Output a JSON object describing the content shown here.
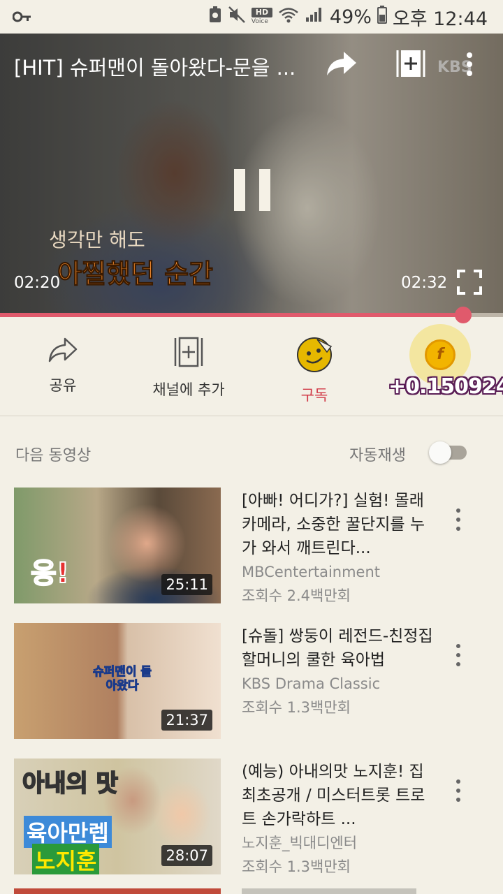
{
  "status_bar": {
    "hd_label": "HD",
    "voice_label": "Voice",
    "battery": "49%",
    "time": "오후 12:44"
  },
  "player": {
    "title": "[HIT] 슈퍼맨이 돌아왔다-문을 ...",
    "current_time": "02:20",
    "duration": "02:32",
    "progress": 0.921,
    "watermark": "KBS",
    "subtitle_line1": "생각만 해도",
    "subtitle_line2": "아찔했던 순간",
    "accent_color": "#e05a6c"
  },
  "actions": {
    "share": "공유",
    "add_to_channel": "채널에 추가",
    "subscribe": "구독",
    "coin_symbol": "f",
    "coin_value": "+0.150924"
  },
  "up_next": {
    "label": "다음 동영상",
    "autoplay_label": "자동재생",
    "autoplay_on": false
  },
  "videos": [
    {
      "title": "[아빠! 어디가?] 실험! 몰래 카메라, 소중한 꿀단지를 누가 와서 깨트린다...",
      "channel": "MBCentertainment",
      "views": "조회수 2.4백만회",
      "duration": "25:11",
      "thumb_text": "응!"
    },
    {
      "title": "[슈돌] 쌍둥이 레전드-친정집 할머니의 쿨한 육아법",
      "channel": "KBS Drama Classic",
      "views": "조회수 1.3백만회",
      "duration": "21:37",
      "thumb_text": "슈퍼맨이 돌아왔다"
    },
    {
      "title": "(예능) 아내의맛 노지훈! 집 최초공개  / 미스터트롯 트로트 손가락하트 ...",
      "channel": "노지훈_빅대디엔터",
      "views": "조회수 1.3백만회",
      "duration": "28:07",
      "thumb_text_top": "아내의 맛",
      "thumb_text_mid": "육아만렙",
      "thumb_text_bot": "노지훈"
    }
  ]
}
